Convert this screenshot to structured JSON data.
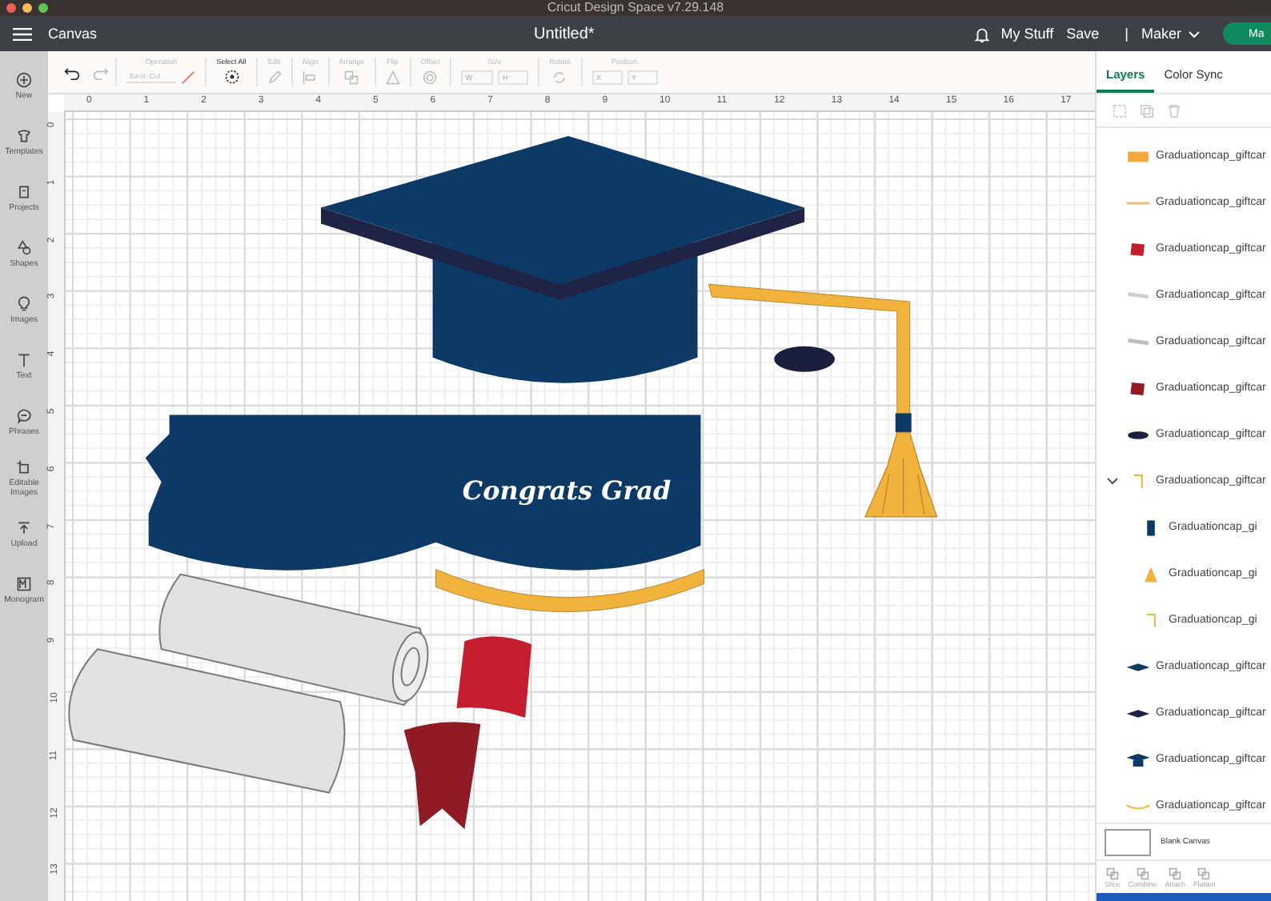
{
  "window": {
    "title": "Cricut Design Space  v7.29.148"
  },
  "header": {
    "menu_label": "Canvas",
    "document_title": "Untitled*",
    "links": [
      "My Stuff",
      "Save"
    ],
    "separator": "|",
    "machine": "Maker",
    "make_button": "Ma"
  },
  "sidebar": {
    "items": [
      {
        "kind": "new",
        "label": "New"
      },
      {
        "kind": "templates",
        "label": "Templates"
      },
      {
        "kind": "projects",
        "label": "Projects"
      },
      {
        "kind": "shapes",
        "label": "Shapes"
      },
      {
        "kind": "images",
        "label": "Images"
      },
      {
        "kind": "text",
        "label": "Text"
      },
      {
        "kind": "phrases",
        "label": "Phrases"
      },
      {
        "kind": "editable",
        "label": "Editable Images"
      },
      {
        "kind": "upload",
        "label": "Upload"
      },
      {
        "kind": "monogram",
        "label": "Monogram"
      }
    ]
  },
  "toolbar": {
    "history": [
      {
        "kind": "undo",
        "disabled": false
      },
      {
        "kind": "redo",
        "disabled": true
      }
    ],
    "items": [
      {
        "kind": "operation",
        "label": "Operation",
        "value": "Basic Cut",
        "disabled": true
      },
      {
        "kind": "select_all",
        "label": "Select All",
        "disabled": false
      },
      {
        "kind": "edit",
        "label": "Edit",
        "disabled": true
      },
      {
        "kind": "align",
        "label": "Align",
        "disabled": true
      },
      {
        "kind": "arrange",
        "label": "Arrange",
        "disabled": true
      },
      {
        "kind": "flip",
        "label": "Flip",
        "disabled": true
      },
      {
        "kind": "offset",
        "label": "Offset",
        "disabled": true
      },
      {
        "kind": "size",
        "label": "Size",
        "fields": [
          "W",
          "H"
        ],
        "disabled": true
      },
      {
        "kind": "rotate",
        "label": "Rotate",
        "disabled": true
      },
      {
        "kind": "position",
        "label": "Position",
        "fields": [
          "X",
          "Y"
        ],
        "disabled": true
      }
    ]
  },
  "ruler": {
    "x_ticks": [
      "0",
      "1",
      "2",
      "3",
      "4",
      "5",
      "6",
      "7",
      "8",
      "9",
      "10",
      "11",
      "12",
      "13",
      "14",
      "15",
      "16",
      "17"
    ],
    "y_ticks": [
      "0",
      "1",
      "2",
      "3",
      "4",
      "5",
      "6",
      "7",
      "8",
      "9",
      "10",
      "11",
      "12",
      "13"
    ]
  },
  "canvas": {
    "design_text": "Congrats Grad"
  },
  "layers_panel": {
    "tabs": [
      {
        "label": "Layers",
        "selected": true
      },
      {
        "label": "Color Sync",
        "selected": false
      }
    ],
    "layers": [
      {
        "name": "Graduationcap_giftcar",
        "kind": "rect",
        "color": "#f5a93a"
      },
      {
        "name": "Graduationcap_giftcar",
        "kind": "line",
        "color": "#e8c77a"
      },
      {
        "name": "Graduationcap_giftcar",
        "kind": "flag",
        "color": "#c41e2e"
      },
      {
        "name": "Graduationcap_giftcar",
        "kind": "scroll",
        "color": "#cfcfcf"
      },
      {
        "name": "Graduationcap_giftcar",
        "kind": "scroll",
        "color": "#bdbdbd"
      },
      {
        "name": "Graduationcap_giftcar",
        "kind": "flag",
        "color": "#8e1b25"
      },
      {
        "name": "Graduationcap_giftcar",
        "kind": "ellipse",
        "color": "#1a1f3d"
      },
      {
        "name": "Graduationcap_giftcar",
        "kind": "hook",
        "color": "#f2b33d",
        "expanded": true,
        "children": [
          {
            "name": "Graduationcap_gi",
            "kind": "bar",
            "color": "#0d3966"
          },
          {
            "name": "Graduationcap_gi",
            "kind": "tassel",
            "color": "#f2b33d"
          },
          {
            "name": "Graduationcap_gi",
            "kind": "hook",
            "color": "#f2b33d"
          }
        ]
      },
      {
        "name": "Graduationcap_giftcar",
        "kind": "board",
        "color": "#0d3966"
      },
      {
        "name": "Graduationcap_giftcar",
        "kind": "board",
        "color": "#1f2447"
      },
      {
        "name": "Graduationcap_giftcar",
        "kind": "cap",
        "color": "#0d3966"
      },
      {
        "name": "Graduationcap_giftcar",
        "kind": "arc",
        "color": "#f2b33d"
      }
    ],
    "blank_canvas": "Blank Canvas",
    "actions": [
      {
        "label": "Slice",
        "disabled": true
      },
      {
        "label": "Combine",
        "disabled": true
      },
      {
        "label": "Attach",
        "disabled": true
      },
      {
        "label": "Flatten",
        "disabled": true
      }
    ]
  }
}
